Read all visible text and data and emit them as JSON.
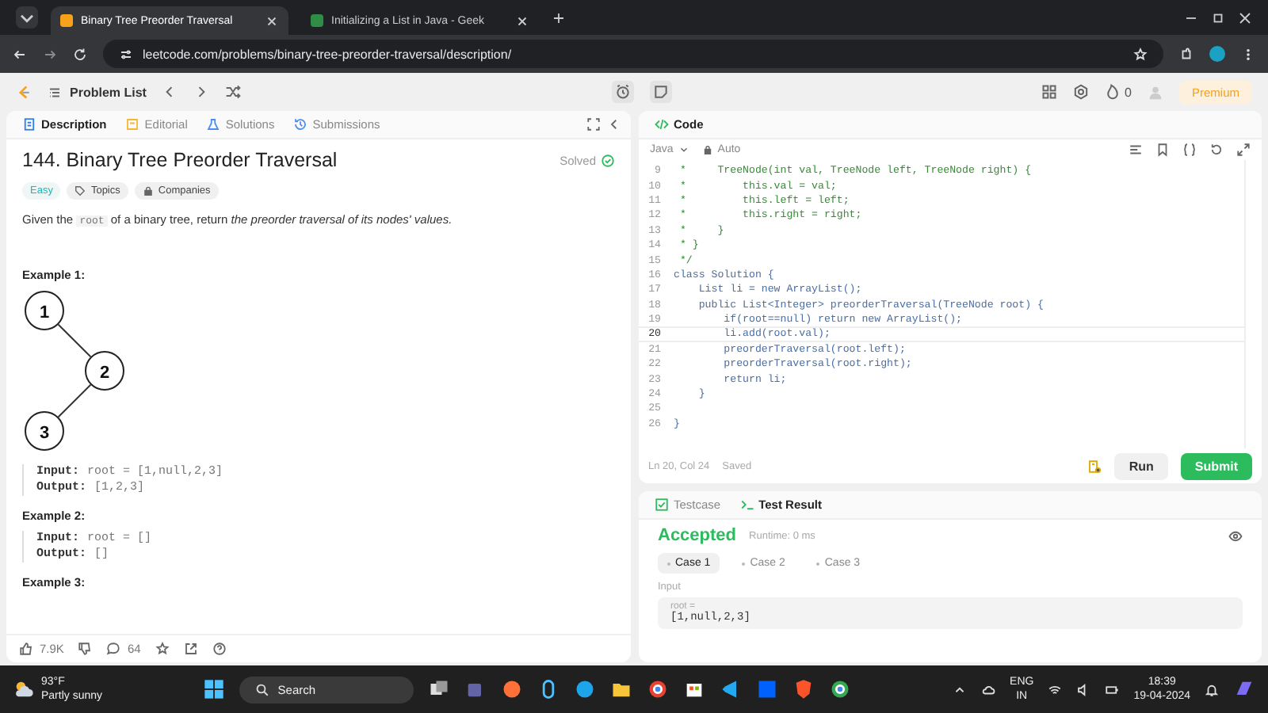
{
  "browser": {
    "tabs": [
      {
        "title": "Binary Tree Preorder Traversal",
        "selected": true
      },
      {
        "title": "Initializing a List in Java - Geek",
        "selected": false
      }
    ],
    "url": "leetcode.com/problems/binary-tree-preorder-traversal/description/"
  },
  "nav": {
    "problem_list": "Problem List",
    "streak": "0",
    "premium": "Premium"
  },
  "left_tabs": [
    {
      "label": "Description",
      "selected": true
    },
    {
      "label": "Editorial",
      "selected": false
    },
    {
      "label": "Solutions",
      "selected": false
    },
    {
      "label": "Submissions",
      "selected": false
    }
  ],
  "problem": {
    "title": "144. Binary Tree Preorder Traversal",
    "status": "Solved",
    "difficulty": "Easy",
    "tags": [
      "Topics",
      "Companies"
    ],
    "description": [
      {
        "text": "Given the ",
        "kind": "plain"
      },
      {
        "text": "root",
        "kind": "code"
      },
      {
        "text": " of a binary tree, return ",
        "kind": "plain"
      },
      {
        "text": "the preorder traversal of its nodes' values.",
        "kind": "emphasis"
      }
    ],
    "examples": [
      {
        "title": "Example 1:",
        "tree": [
          "1",
          "2",
          "3"
        ],
        "input_label": "Input:",
        "input": "root = [1,null,2,3]",
        "output_label": "Output:",
        "output": "[1,2,3]"
      },
      {
        "title": "Example 2:",
        "input_label": "Input:",
        "input": "root = []",
        "output_label": "Output:",
        "output": "[]"
      },
      {
        "title": "Example 3:"
      }
    ],
    "likes": "7.9K",
    "comments": "64"
  },
  "code_panel": {
    "title": "Code",
    "language": "Java",
    "mode": "Auto",
    "status": "Ln 20, Col 24",
    "saved": "Saved",
    "lines": [
      {
        "n": "9",
        "text": " *     TreeNode(int val, TreeNode left, TreeNode right) {",
        "kind": "comment",
        "current": false
      },
      {
        "n": "10",
        "text": " *         this.val = val;",
        "kind": "comment",
        "current": false
      },
      {
        "n": "11",
        "text": " *         this.left = left;",
        "kind": "comment",
        "current": false
      },
      {
        "n": "12",
        "text": " *         this.right = right;",
        "kind": "comment",
        "current": false
      },
      {
        "n": "13",
        "text": " *     }",
        "kind": "comment",
        "current": false
      },
      {
        "n": "14",
        "text": " * }",
        "kind": "comment",
        "current": false
      },
      {
        "n": "15",
        "text": " */",
        "kind": "comment",
        "current": false
      },
      {
        "n": "16",
        "text": "class Solution {",
        "kind": "code",
        "current": false
      },
      {
        "n": "17",
        "text": "    List li = new ArrayList();",
        "kind": "code",
        "current": false
      },
      {
        "n": "18",
        "text": "    public List<Integer> preorderTraversal(TreeNode root) {",
        "kind": "code",
        "current": false
      },
      {
        "n": "19",
        "text": "        if(root==null) return new ArrayList();",
        "kind": "code",
        "current": false
      },
      {
        "n": "20",
        "text": "        li.add(root.val);",
        "kind": "code",
        "current": true
      },
      {
        "n": "21",
        "text": "        preorderTraversal(root.left);",
        "kind": "code",
        "current": false
      },
      {
        "n": "22",
        "text": "        preorderTraversal(root.right);",
        "kind": "code",
        "current": false
      },
      {
        "n": "23",
        "text": "        return li;",
        "kind": "code",
        "current": false
      },
      {
        "n": "24",
        "text": "    }",
        "kind": "code",
        "current": false
      },
      {
        "n": "25",
        "kind": "code",
        "current": false
      },
      {
        "n": "26",
        "text": "}",
        "kind": "code",
        "current": false
      }
    ],
    "run": "Run",
    "submit": "Submit"
  },
  "result_panel": {
    "tabs": [
      {
        "label": "Testcase",
        "selected": false
      },
      {
        "label": "Test Result",
        "selected": true
      }
    ],
    "verdict": "Accepted",
    "runtime": "Runtime: 0 ms",
    "cases": [
      {
        "label": "Case 1",
        "selected": true
      },
      {
        "label": "Case 2",
        "selected": false
      },
      {
        "label": "Case 3",
        "selected": false
      }
    ],
    "input_label": "Input",
    "var_name": "root =",
    "var_value": "[1,null,2,3]"
  },
  "taskbar": {
    "temperature": "93°F",
    "weather": "Partly sunny",
    "search": "Search",
    "language": "ENG",
    "region": "IN",
    "time": "18:39",
    "date": "19-04-2024"
  }
}
